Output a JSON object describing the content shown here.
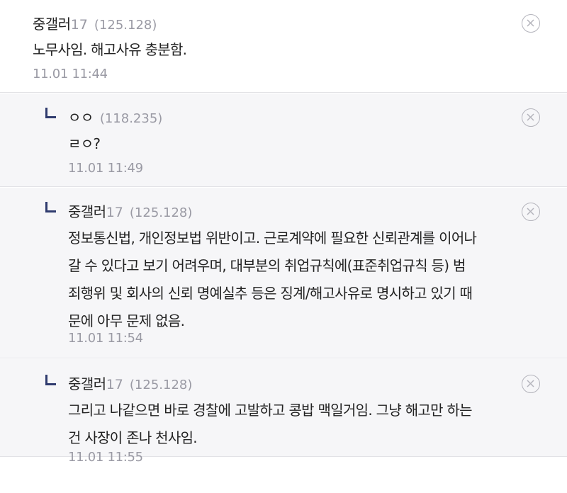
{
  "comments": [
    {
      "nick": "중갤러",
      "nick_num": "17",
      "ip": "(125.128)",
      "text_lines": [
        "노무사임. 해고사유 충분함."
      ],
      "time": "11.01 11:44",
      "is_reply": false
    },
    {
      "nick": "ㅇㅇ",
      "nick_num": "",
      "ip": "(118.235)",
      "text_lines": [
        "ㄹㅇ?"
      ],
      "time": "11.01 11:49",
      "is_reply": true
    },
    {
      "nick": "중갤러",
      "nick_num": "17",
      "ip": "(125.128)",
      "text_lines": [
        "정보통신법, 개인정보법 위반이고. 근로계약에 필요한 신뢰관계를 이어나",
        "갈 수 있다고 보기 어려우며, 대부분의 취업규칙에(표준취업규칙 등) 범",
        "죄행위 및 회사의 신뢰 명예실추 등은 징계/해고사유로 명시하고 있기 때",
        "문에 아무 문제 없음."
      ],
      "time": "11.01 11:54",
      "is_reply": true
    },
    {
      "nick": "중갤러",
      "nick_num": "17",
      "ip": "(125.128)",
      "text_lines": [
        "그리고 나같으면 바로 경찰에 고발하고 콩밥 맥일거임. 그냥 해고만 하는",
        "건 사장이 존나 천사임."
      ],
      "time": "11.01 11:55",
      "is_reply": true
    }
  ],
  "icons": {
    "reply": "reply-arrow-icon",
    "delete": "close-circle-icon"
  },
  "colors": {
    "reply_bg": "#f6f6f8",
    "meta_gray": "#9a9aa4",
    "reply_arrow": "#2f3b6e",
    "divider": "#e2e2e6"
  }
}
